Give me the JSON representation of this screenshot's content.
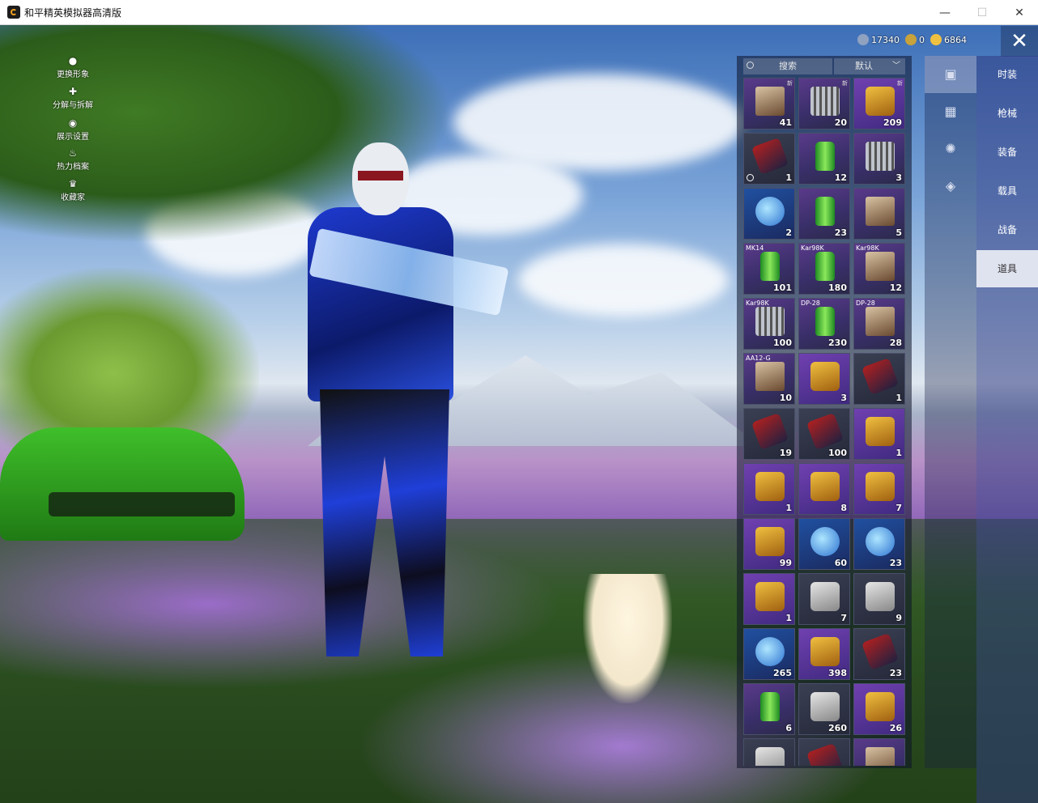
{
  "window": {
    "title": "和平精英模拟器高清版",
    "minimize_glyph": "—",
    "maximize_glyph": "☐",
    "close_glyph": "✕"
  },
  "side_menu": [
    {
      "label": "更换形象",
      "icon": "person-icon",
      "glyph": "●"
    },
    {
      "label": "分解与拆解",
      "icon": "puzzle-icon",
      "glyph": "✚"
    },
    {
      "label": "展示设置",
      "icon": "eye-icon",
      "glyph": "◉"
    },
    {
      "label": "热力档案",
      "icon": "flame-icon",
      "glyph": "♨"
    },
    {
      "label": "收藏家",
      "icon": "crown-icon",
      "glyph": "♛"
    }
  ],
  "currency": [
    {
      "icon": "gear-coin-icon",
      "value": "17340",
      "color": "#8fa2c0"
    },
    {
      "icon": "medal-coin-icon",
      "value": "0",
      "color": "#c8a23a"
    },
    {
      "icon": "gold-coin-icon",
      "value": "6864",
      "color": "#f0c040"
    }
  ],
  "close_label": "✕",
  "inventory": {
    "search_placeholder": "搜索",
    "sort_label": "默认",
    "sort_chevron": "﹀",
    "items": [
      {
        "count": "41",
        "tag": "",
        "art": "box",
        "new": "新"
      },
      {
        "count": "20",
        "tag": "",
        "art": "spring",
        "new": "新"
      },
      {
        "count": "209",
        "tag": "",
        "art": "gold",
        "new": "新"
      },
      {
        "count": "1",
        "tag": "",
        "art": "ticket",
        "new": "",
        "clock": true
      },
      {
        "count": "12",
        "tag": "",
        "art": "can",
        "new": ""
      },
      {
        "count": "3",
        "tag": "",
        "art": "spring",
        "new": ""
      },
      {
        "count": "2",
        "tag": "",
        "art": "orb",
        "new": ""
      },
      {
        "count": "23",
        "tag": "",
        "art": "can",
        "new": ""
      },
      {
        "count": "5",
        "tag": "",
        "art": "box",
        "new": ""
      },
      {
        "count": "101",
        "tag": "MK14",
        "art": "can",
        "new": ""
      },
      {
        "count": "180",
        "tag": "Kar98K",
        "art": "can",
        "new": ""
      },
      {
        "count": "12",
        "tag": "Kar98K",
        "art": "box",
        "new": ""
      },
      {
        "count": "100",
        "tag": "Kar98K",
        "art": "spring",
        "new": ""
      },
      {
        "count": "230",
        "tag": "DP-28",
        "art": "can",
        "new": ""
      },
      {
        "count": "28",
        "tag": "DP-28",
        "art": "box",
        "new": ""
      },
      {
        "count": "10",
        "tag": "AA12-G",
        "art": "box",
        "new": ""
      },
      {
        "count": "3",
        "tag": "",
        "art": "gold",
        "new": ""
      },
      {
        "count": "1",
        "tag": "",
        "art": "ticket",
        "new": ""
      },
      {
        "count": "19",
        "tag": "",
        "art": "ticket",
        "new": ""
      },
      {
        "count": "100",
        "tag": "",
        "art": "ticket",
        "new": ""
      },
      {
        "count": "1",
        "tag": "",
        "art": "gold",
        "new": ""
      },
      {
        "count": "1",
        "tag": "",
        "art": "gold",
        "new": ""
      },
      {
        "count": "8",
        "tag": "",
        "art": "gold",
        "new": ""
      },
      {
        "count": "7",
        "tag": "",
        "art": "gold",
        "new": ""
      },
      {
        "count": "99",
        "tag": "",
        "art": "gold",
        "new": ""
      },
      {
        "count": "60",
        "tag": "",
        "art": "orb",
        "new": ""
      },
      {
        "count": "23",
        "tag": "",
        "art": "orb",
        "new": ""
      },
      {
        "count": "1",
        "tag": "",
        "art": "gold",
        "new": ""
      },
      {
        "count": "7",
        "tag": "",
        "art": "key",
        "new": ""
      },
      {
        "count": "9",
        "tag": "",
        "art": "key",
        "new": ""
      },
      {
        "count": "265",
        "tag": "",
        "art": "orb",
        "new": ""
      },
      {
        "count": "398",
        "tag": "",
        "art": "gold",
        "new": ""
      },
      {
        "count": "23",
        "tag": "",
        "art": "ticket",
        "new": ""
      },
      {
        "count": "6",
        "tag": "",
        "art": "can",
        "new": ""
      },
      {
        "count": "260",
        "tag": "",
        "art": "key",
        "new": ""
      },
      {
        "count": "26",
        "tag": "",
        "art": "gold",
        "new": ""
      },
      {
        "count": "",
        "tag": "",
        "art": "key",
        "new": ""
      },
      {
        "count": "",
        "tag": "",
        "art": "ticket",
        "new": ""
      },
      {
        "count": "",
        "tag": "",
        "art": "box",
        "new": ""
      }
    ]
  },
  "icon_strip": [
    {
      "icon": "card-icon",
      "glyph": "▣",
      "active": true
    },
    {
      "icon": "calendar-icon",
      "glyph": "▦",
      "active": false
    },
    {
      "icon": "firework-icon",
      "glyph": "✺",
      "active": false
    },
    {
      "icon": "ticket-icon",
      "glyph": "◈",
      "active": false
    }
  ],
  "tabs": [
    {
      "label": "时装",
      "active": false
    },
    {
      "label": "枪械",
      "active": false
    },
    {
      "label": "装备",
      "active": false
    },
    {
      "label": "载具",
      "active": false
    },
    {
      "label": "战备",
      "active": false
    },
    {
      "label": "道具",
      "active": true
    }
  ]
}
